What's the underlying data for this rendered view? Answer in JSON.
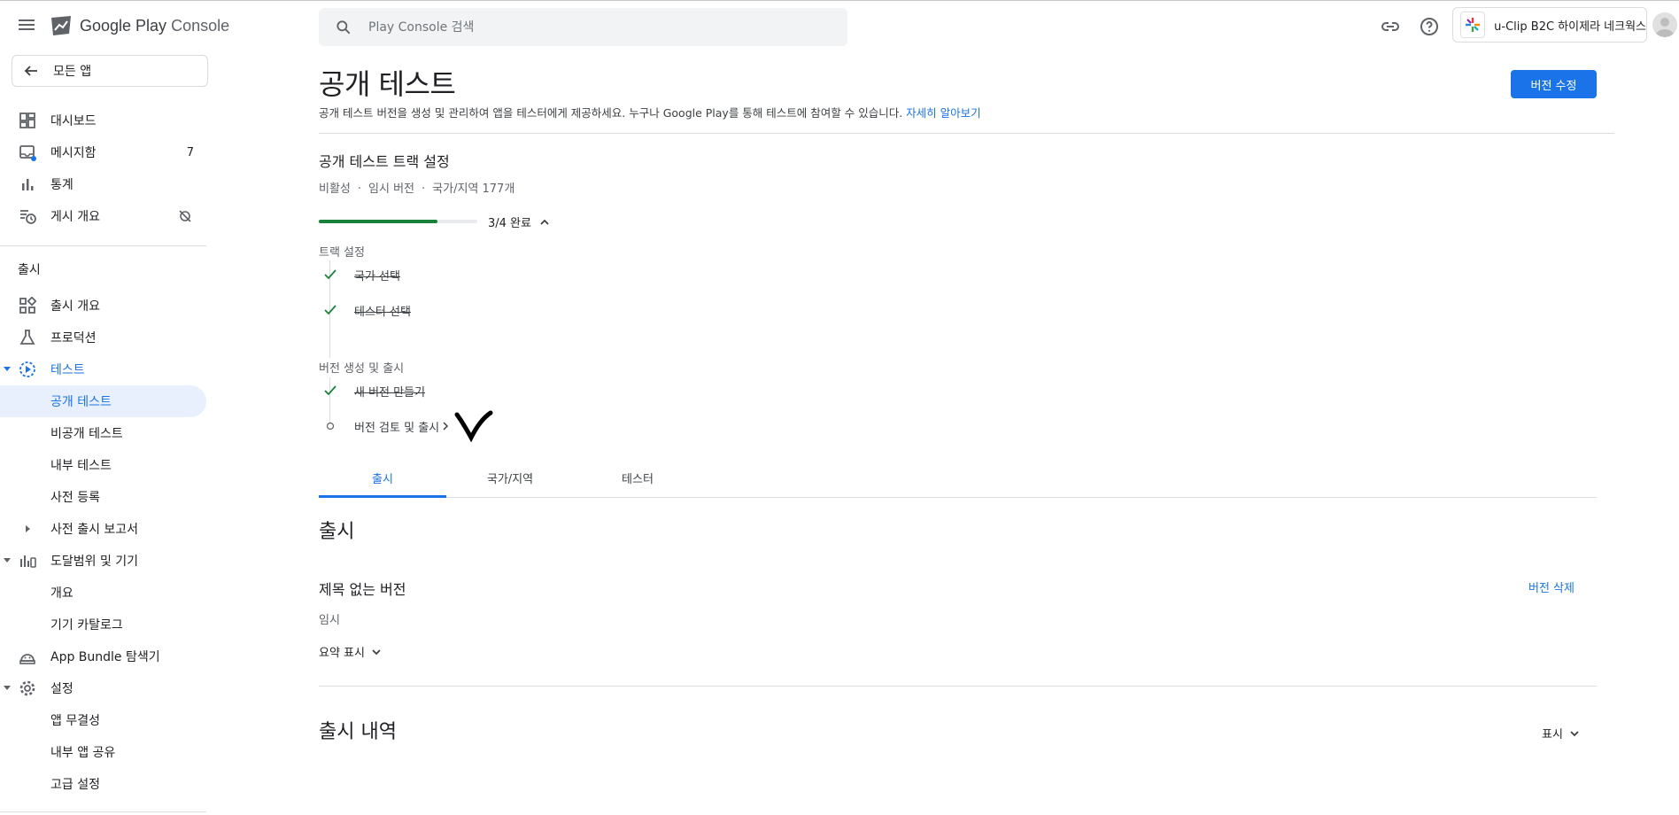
{
  "app": {
    "product_name": "Google Play Console"
  },
  "search": {
    "placeholder": "Play Console 검색"
  },
  "account": {
    "app_name": "u-Clip B2C 하이제라 네크웍스"
  },
  "sidebar": {
    "back_label": "모든 앱",
    "items": [
      {
        "label": "대시보드",
        "icon": "dashboard-icon"
      },
      {
        "label": "메시지함",
        "icon": "inbox-icon",
        "count": "7"
      },
      {
        "label": "통계",
        "icon": "bar-chart-icon"
      },
      {
        "label": "게시 개요",
        "icon": "publishing-icon"
      }
    ],
    "section_release": "출시",
    "release_items": [
      {
        "label": "출시 개요"
      },
      {
        "label": "프로덕션"
      },
      {
        "label": "테스트"
      },
      {
        "label": "공개 테스트"
      },
      {
        "label": "비공개 테스트"
      },
      {
        "label": "내부 테스트"
      },
      {
        "label": "사전 등록"
      },
      {
        "label": "사전 출시 보고서"
      },
      {
        "label": "도달범위 및 기기"
      },
      {
        "label": "개요"
      },
      {
        "label": "기기 카탈로그"
      },
      {
        "label": "App Bundle 탐색기"
      },
      {
        "label": "설정"
      },
      {
        "label": "앱 무결성"
      },
      {
        "label": "내부 앱 공유"
      },
      {
        "label": "고급 설정"
      }
    ]
  },
  "main": {
    "title": "공개 테스트",
    "description": "공개 테스트 버전을 생성 및 관리하여 앱을 테스터에게 제공하세요. 누구나 Google Play를 통해 테스트에 참여할 수 있습니다.",
    "learn_more": "자세히 알아보기",
    "edit_button": "버전 수정",
    "track": {
      "title": "공개 테스트 트랙 설정",
      "status": "비활성",
      "release_type": "임시 버전",
      "countries": "국가/지역 177개",
      "progress_label": "3/4 완료",
      "progress_fraction": 0.75,
      "group1_label": "트랙 설정",
      "step1": "국가 선택",
      "step2": "테스터 선택",
      "group2_label": "버전 생성 및 출시",
      "step3": "새 버전 만들기",
      "step4": "버전 검토 및 출시"
    },
    "tabs": [
      "출시",
      "국가/지역",
      "테스터"
    ],
    "release": {
      "heading": "출시",
      "name": "제목 없는 버전",
      "delete": "버전 삭제",
      "status": "임시",
      "summary": "요약 표시"
    },
    "history": {
      "heading": "출시 내역",
      "show": "표시"
    }
  },
  "colors": {
    "accent": "#1a73e8",
    "success": "#188038",
    "active_bg": "#e8f0fe"
  }
}
